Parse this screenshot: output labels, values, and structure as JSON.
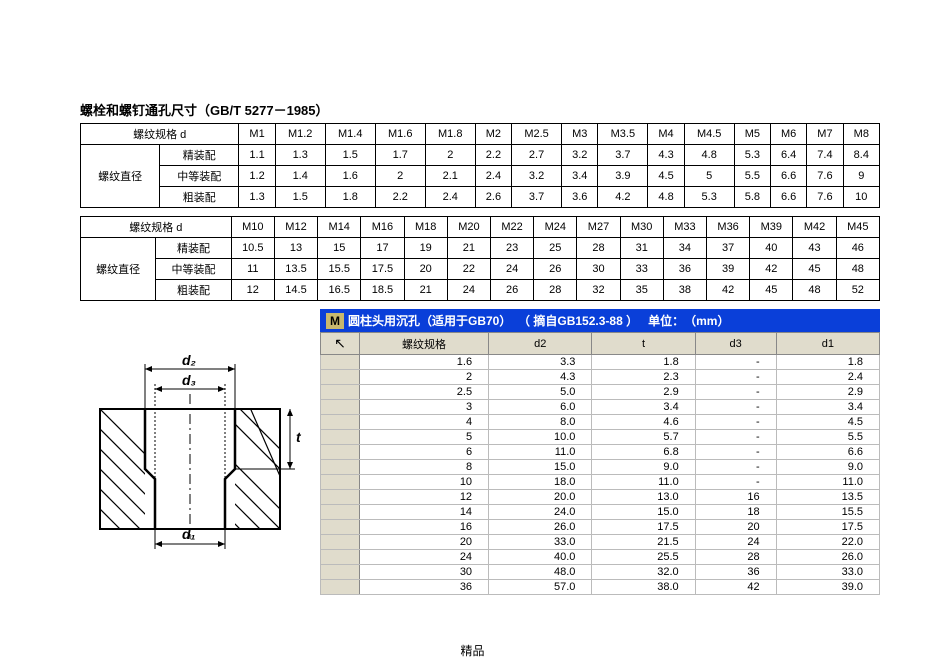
{
  "title": "螺栓和螺钉通孔尺寸（GB/T 5277－1985）",
  "footer": "精品",
  "table1a": {
    "header_row": [
      "螺纹规格 d",
      "",
      "M1",
      "M1.2",
      "M1.4",
      "M1.6",
      "M1.8",
      "M2",
      "M2.5",
      "M3",
      "M3.5",
      "M4",
      "M4.5",
      "M5",
      "M6",
      "M7",
      "M8"
    ],
    "group_label": "螺纹直径",
    "rows": [
      {
        "label": "精装配",
        "values": [
          "1.1",
          "1.3",
          "1.5",
          "1.7",
          "2",
          "2.2",
          "2.7",
          "3.2",
          "3.7",
          "4.3",
          "4.8",
          "5.3",
          "6.4",
          "7.4",
          "8.4"
        ]
      },
      {
        "label": "中等装配",
        "values": [
          "1.2",
          "1.4",
          "1.6",
          "2",
          "2.1",
          "2.4",
          "3.2",
          "3.4",
          "3.9",
          "4.5",
          "5",
          "5.5",
          "6.6",
          "7.6",
          "9"
        ]
      },
      {
        "label": "粗装配",
        "values": [
          "1.3",
          "1.5",
          "1.8",
          "2.2",
          "2.4",
          "2.6",
          "3.7",
          "3.6",
          "4.2",
          "4.8",
          "5.3",
          "5.8",
          "6.6",
          "7.6",
          "10"
        ]
      }
    ]
  },
  "table1b": {
    "header_row": [
      "螺纹规格 d",
      "",
      "M10",
      "M12",
      "M14",
      "M16",
      "M18",
      "M20",
      "M22",
      "M24",
      "M27",
      "M30",
      "M33",
      "M36",
      "M39",
      "M42",
      "M45"
    ],
    "group_label": "螺纹直径",
    "rows": [
      {
        "label": "精装配",
        "values": [
          "10.5",
          "13",
          "15",
          "17",
          "19",
          "21",
          "23",
          "25",
          "28",
          "31",
          "34",
          "37",
          "40",
          "43",
          "46"
        ]
      },
      {
        "label": "中等装配",
        "values": [
          "11",
          "13.5",
          "15.5",
          "17.5",
          "20",
          "22",
          "24",
          "26",
          "30",
          "33",
          "36",
          "39",
          "42",
          "45",
          "48"
        ]
      },
      {
        "label": "粗装配",
        "values": [
          "12",
          "14.5",
          "16.5",
          "18.5",
          "21",
          "24",
          "26",
          "28",
          "32",
          "35",
          "38",
          "42",
          "45",
          "48",
          "52"
        ]
      }
    ]
  },
  "diagram_labels": {
    "d1": "d₁",
    "d2": "d₂",
    "d3": "d₃",
    "t": "t"
  },
  "table2": {
    "title_prefix": "M",
    "title_text": "圆柱头用沉孔（适用于GB70）",
    "title_source": "（ 摘自GB152.3-88 ）",
    "title_unit_label": "单位：",
    "title_unit": "（mm）",
    "columns": [
      "螺纹规格",
      "d2",
      "t",
      "d3",
      "d1"
    ],
    "rows": [
      [
        "1.6",
        "3.3",
        "1.8",
        "-",
        "1.8"
      ],
      [
        "2",
        "4.3",
        "2.3",
        "-",
        "2.4"
      ],
      [
        "2.5",
        "5.0",
        "2.9",
        "-",
        "2.9"
      ],
      [
        "3",
        "6.0",
        "3.4",
        "-",
        "3.4"
      ],
      [
        "4",
        "8.0",
        "4.6",
        "-",
        "4.5"
      ],
      [
        "5",
        "10.0",
        "5.7",
        "-",
        "5.5"
      ],
      [
        "6",
        "11.0",
        "6.8",
        "-",
        "6.6"
      ],
      [
        "8",
        "15.0",
        "9.0",
        "-",
        "9.0"
      ],
      [
        "10",
        "18.0",
        "11.0",
        "-",
        "11.0"
      ],
      [
        "12",
        "20.0",
        "13.0",
        "16",
        "13.5"
      ],
      [
        "14",
        "24.0",
        "15.0",
        "18",
        "15.5"
      ],
      [
        "16",
        "26.0",
        "17.5",
        "20",
        "17.5"
      ],
      [
        "20",
        "33.0",
        "21.5",
        "24",
        "22.0"
      ],
      [
        "24",
        "40.0",
        "25.5",
        "28",
        "26.0"
      ],
      [
        "30",
        "48.0",
        "32.0",
        "36",
        "33.0"
      ],
      [
        "36",
        "57.0",
        "38.0",
        "42",
        "39.0"
      ]
    ]
  }
}
